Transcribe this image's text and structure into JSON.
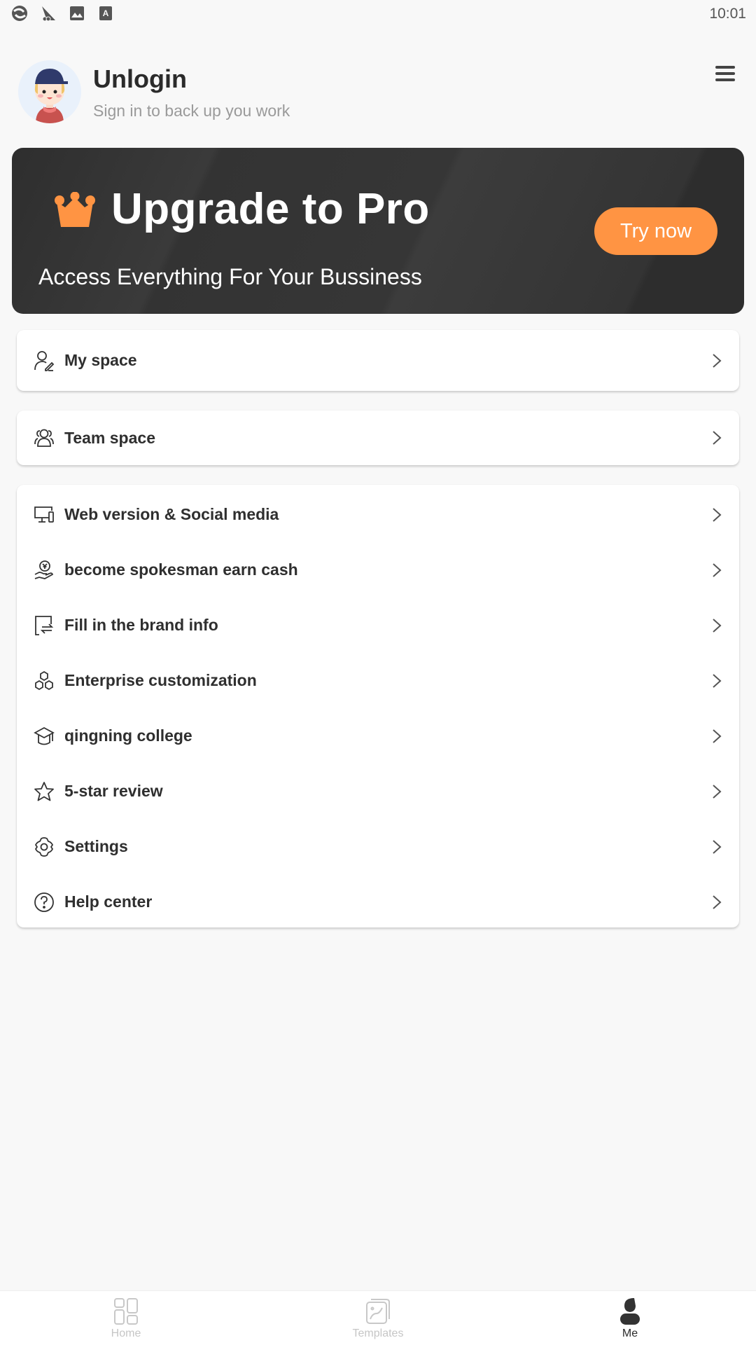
{
  "status_bar": {
    "time": "10:01",
    "icons": [
      "sync-icon",
      "vpn-icon",
      "image-icon",
      "font-icon"
    ]
  },
  "profile": {
    "name": "Unlogin",
    "subtitle": "Sign in to back up you work",
    "menu_icon": "hamburger-menu-icon"
  },
  "pro_banner": {
    "title": "Upgrade to Pro",
    "subtitle": "Access Everything For Your Bussiness",
    "button_label": "Try now",
    "accent_color": "#ff9443",
    "background_color": "#333333"
  },
  "cards": {
    "my_space": {
      "label": "My space",
      "icon": "user-edit-icon"
    },
    "team_space": {
      "label": "Team space",
      "icon": "team-icon"
    }
  },
  "menu": {
    "items": [
      {
        "label": "Web version & Social media",
        "icon": "devices-icon"
      },
      {
        "label": "become spokesman earn cash",
        "icon": "cash-hand-icon"
      },
      {
        "label": "Fill in the brand info",
        "icon": "brand-swap-icon"
      },
      {
        "label": "Enterprise customization",
        "icon": "hexagons-icon"
      },
      {
        "label": "qingning college",
        "icon": "graduation-cap-icon"
      },
      {
        "label": "5-star review",
        "icon": "star-icon"
      },
      {
        "label": "Settings",
        "icon": "gear-icon"
      },
      {
        "label": "Help center",
        "icon": "help-circle-icon"
      }
    ]
  },
  "bottom_nav": {
    "items": [
      {
        "label": "Home",
        "icon": "grid-icon",
        "active": false
      },
      {
        "label": "Templates",
        "icon": "templates-icon",
        "active": false
      },
      {
        "label": "Me",
        "icon": "person-icon",
        "active": true
      }
    ]
  }
}
